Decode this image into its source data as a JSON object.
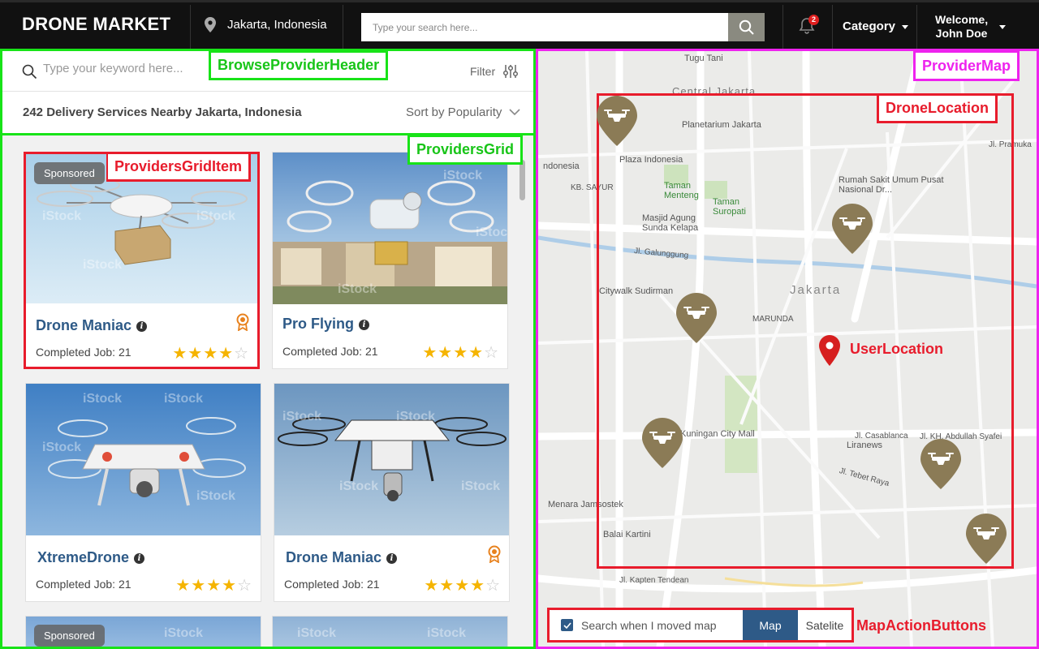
{
  "header": {
    "logo": "DRONE MARKET",
    "location": "Jakarta, Indonesia",
    "search_placeholder": "Type your search here...",
    "notifications_count": "2",
    "category": "Category",
    "welcome_line1": "Welcome,",
    "welcome_line2": "John Doe"
  },
  "browse": {
    "keyword_placeholder": "Type your keyword here...",
    "filter": "Filter",
    "results": "242 Delivery Services Nearby Jakarta, Indonesia",
    "sort": "Sort by Popularity"
  },
  "providers": [
    {
      "name": "Drone Maniac",
      "completed": "Completed Job: 21",
      "rating": 4,
      "sponsored": "Sponsored",
      "award": true
    },
    {
      "name": "Pro Flying",
      "completed": "Completed Job: 21",
      "rating": 4,
      "sponsored": "",
      "award": false
    },
    {
      "name": "XtremeDrone",
      "completed": "Completed Job: 21",
      "rating": 4,
      "sponsored": "",
      "award": false
    },
    {
      "name": "Drone Maniac",
      "completed": "Completed Job: 21",
      "rating": 4,
      "sponsored": "",
      "award": true
    },
    {
      "name": "",
      "completed": "",
      "rating": 0,
      "sponsored": "Sponsored",
      "award": false
    },
    {
      "name": "",
      "completed": "",
      "rating": 0,
      "sponsored": "",
      "award": false
    }
  ],
  "watermark": "iStock",
  "map": {
    "labels": {
      "tugu_tani": "Tugu Tani",
      "central_jakarta": "Central Jakarta",
      "planetarium": "Planetarium Jakarta",
      "plaza_indonesia": "Plaza Indonesia",
      "rumah_sakit": "Rumah Sakit Umum Pusat Nasional Dr...",
      "taman_menteng": "Taman Menteng",
      "taman_suropati": "Taman Suropati",
      "masjid": "Masjid Agung Sunda Kelapa",
      "galunggung": "Jl. Galunggung",
      "citywalk": "Citywalk Sudirman",
      "jakarta": "Jakarta",
      "marunda": "MARUNDA",
      "kuningan": "Kuningan City Mall",
      "casablanca": "Jl. Casablanca",
      "liranews": "Liranews",
      "menara": "Menara Jamsostek",
      "balai": "Balai Kartini",
      "kapten": "Jl. Kapten Tendean",
      "kb_sayur": "KB. SAYUR",
      "donesia": "ndonesia",
      "pramuka": "Jl. Pramuka",
      "kh_abdullah": "Jl. KH. Abdullah Syafei",
      "tebet_raya": "Jl. Tebet Raya"
    },
    "search_when_moved": "Search when I moved map",
    "map_button": "Map",
    "satellite_button": "Satelite"
  },
  "annotations": {
    "browse_header": "BrowseProviderHeader",
    "providers_grid": "ProvidersGrid",
    "providers_grid_item": "ProvidersGridItem",
    "provider_map": "ProviderMap",
    "drone_location": "DroneLocation",
    "user_location": "UserLocation",
    "map_action_buttons": "MapActionButtons"
  },
  "colors": {
    "accent_blue": "#2e5a87",
    "drone_pin": "#8b7b56",
    "user_pin": "#d61f1f",
    "star": "#f5b400",
    "annotation_red": "#e81c2c",
    "annotation_green": "#18e318",
    "annotation_magenta": "#ee22ee"
  }
}
